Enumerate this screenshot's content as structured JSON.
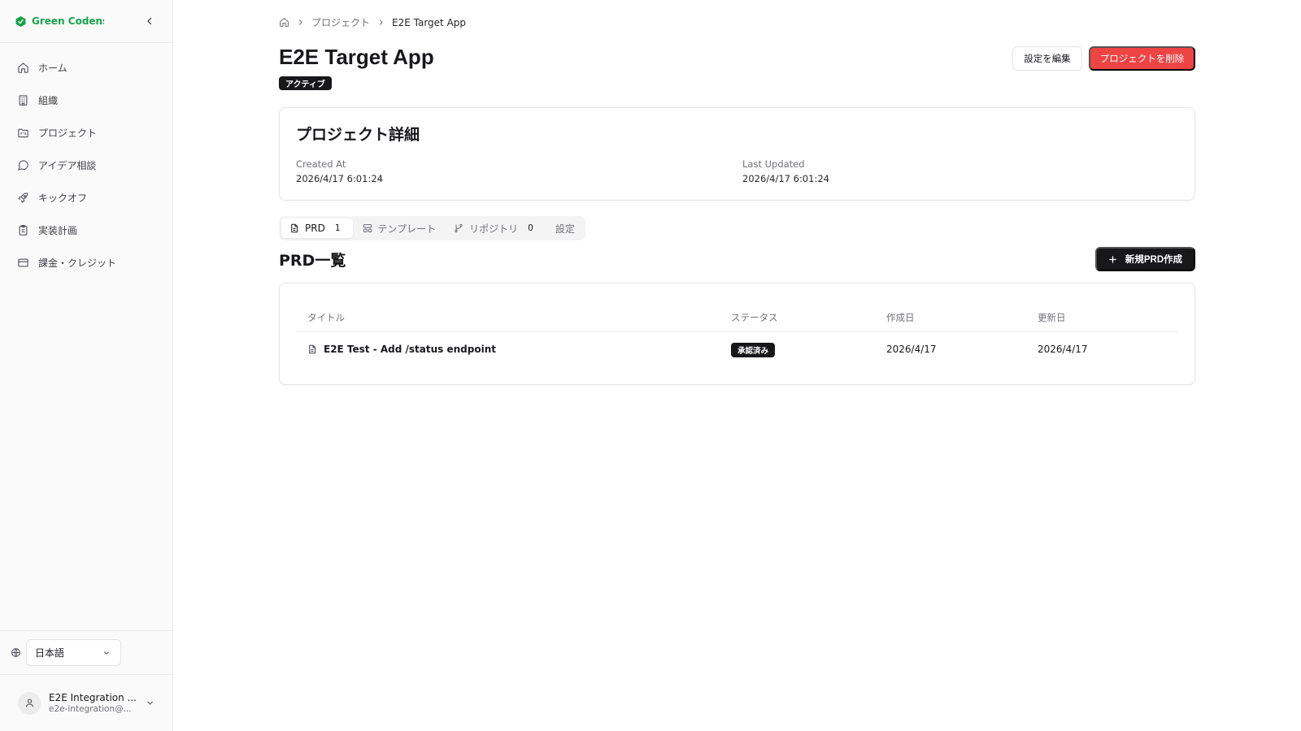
{
  "colors": {
    "brand_green": "#16a34a",
    "danger": "#ef4444",
    "dark": "#18181b",
    "muted": "#71717a",
    "sidebar_bg": "#fafafa",
    "border": "#e4e4e7"
  },
  "sidebar": {
    "brand": "Green Codens",
    "items": [
      {
        "label": "ホーム",
        "icon": "home-icon"
      },
      {
        "label": "組織",
        "icon": "building-icon"
      },
      {
        "label": "プロジェクト",
        "icon": "folder-kanban-icon"
      },
      {
        "label": "アイデア相談",
        "icon": "message-circle-icon"
      },
      {
        "label": "キックオフ",
        "icon": "rocket-icon"
      },
      {
        "label": "実装計画",
        "icon": "clipboard-list-icon"
      },
      {
        "label": "課金・クレジット",
        "icon": "credit-card-icon"
      }
    ],
    "language": "日本語",
    "user": {
      "name": "E2E Integration ...",
      "email": "e2e-integration@..."
    }
  },
  "breadcrumb": {
    "items": [
      "プロジェクト",
      "E2E Target App"
    ]
  },
  "project": {
    "title": "E2E Target App",
    "status": "アクティブ",
    "edit_button": "設定を編集",
    "delete_button": "プロジェクトを削除"
  },
  "details": {
    "title": "プロジェクト詳細",
    "created_label": "Created At",
    "created_value": "2026/4/17 6:01:24",
    "updated_label": "Last Updated",
    "updated_value": "2026/4/17 6:01:24"
  },
  "tabs": [
    {
      "label": "PRD",
      "count": "1",
      "icon": "file-text-icon",
      "active": true
    },
    {
      "label": "テンプレート",
      "count": "",
      "icon": "layout-template-icon",
      "active": false
    },
    {
      "label": "リポジトリ",
      "count": "0",
      "icon": "git-branch-icon",
      "active": false
    },
    {
      "label": "設定",
      "count": "",
      "icon": "",
      "active": false
    }
  ],
  "prd_list": {
    "title": "PRD一覧",
    "new_button": "新規PRD作成",
    "columns": [
      "タイトル",
      "ステータス",
      "作成日",
      "更新日"
    ],
    "rows": [
      {
        "title": "E2E Test - Add /status endpoint",
        "status": "承認済み",
        "created": "2026/4/17",
        "updated": "2026/4/17"
      }
    ]
  }
}
